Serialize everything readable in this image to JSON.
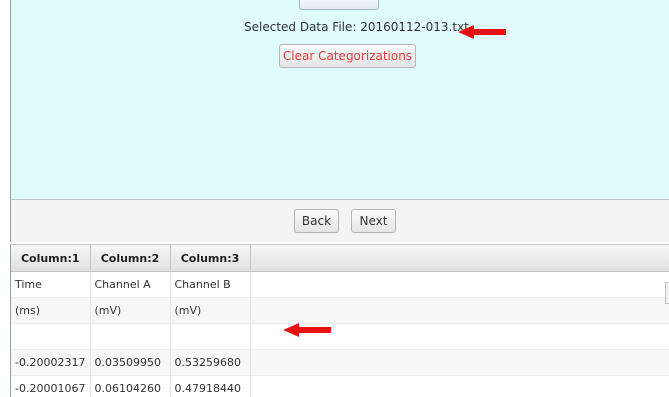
{
  "top_panel": {
    "selected_file_label": "Selected Data File: 20160112-013.txt",
    "clear_button_label": "Clear Categorizations",
    "clear_button_color": "#e23c3c",
    "panel_color": "#e0fbfc"
  },
  "navigation": {
    "back_label": "Back",
    "next_label": "Next"
  },
  "table": {
    "headers": [
      "Column:1",
      "Column:2",
      "Column:3"
    ],
    "rows": [
      [
        "Time",
        "Channel A",
        "Channel B"
      ],
      [
        "(ms)",
        "(mV)",
        "(mV)"
      ],
      [
        "",
        "",
        ""
      ],
      [
        "-0.20002317",
        "0.03509950",
        "0.53259680"
      ],
      [
        "-0.20001067",
        "0.06104260",
        "0.47918440"
      ]
    ]
  },
  "annotations": {
    "arrow_color": "#e81010",
    "arrow_icon": "red-arrow-left-icon"
  }
}
